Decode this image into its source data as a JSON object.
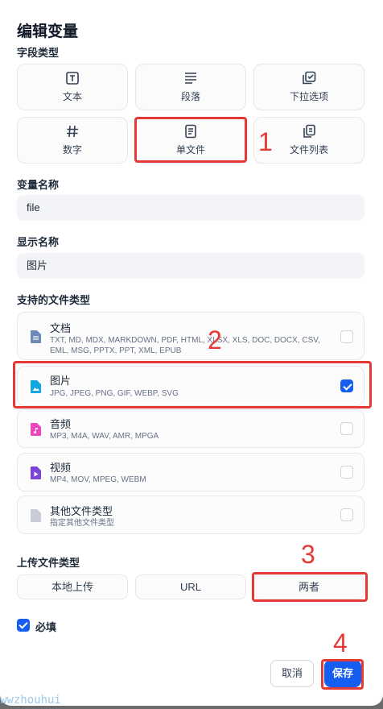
{
  "dialog": {
    "title": "编辑变量"
  },
  "field_type": {
    "label": "字段类型",
    "options": [
      {
        "label": "文本",
        "icon": "text-box-icon"
      },
      {
        "label": "段落",
        "icon": "paragraph-icon"
      },
      {
        "label": "下拉选项",
        "icon": "checkbox-list-icon"
      },
      {
        "label": "数字",
        "icon": "hash-icon"
      },
      {
        "label": "单文件",
        "icon": "file-doc-icon"
      },
      {
        "label": "文件列表",
        "icon": "file-copy-icon"
      }
    ],
    "selected": "单文件"
  },
  "variable_name": {
    "label": "变量名称",
    "value": "file"
  },
  "display_name": {
    "label": "显示名称",
    "value": "图片"
  },
  "supported_types": {
    "label": "支持的文件类型",
    "items": [
      {
        "name": "文档",
        "desc": "TXT, MD, MDX, MARKDOWN, PDF, HTML, XLSX, XLS, DOC, DOCX, CSV, EML, MSG, PPTX, PPT, XML, EPUB",
        "checked": false,
        "color": "#6e8bb8"
      },
      {
        "name": "图片",
        "desc": "JPG, JPEG, PNG, GIF, WEBP, SVG",
        "checked": true,
        "color": "#11a7e0"
      },
      {
        "name": "音频",
        "desc": "MP3, M4A, WAV, AMR, MPGA",
        "checked": false,
        "color": "#ee46bc"
      },
      {
        "name": "视频",
        "desc": "MP4, MOV, MPEG, WEBM",
        "checked": false,
        "color": "#7a44d8"
      },
      {
        "name": "其他文件类型",
        "desc": "指定其他文件类型",
        "checked": false,
        "color": "#c9ccd6"
      }
    ]
  },
  "upload_type": {
    "label": "上传文件类型",
    "options": [
      "本地上传",
      "URL",
      "两者"
    ],
    "selected": "两者"
  },
  "required": {
    "label": "必填",
    "checked": true
  },
  "buttons": {
    "cancel": "取消",
    "save": "保存"
  },
  "annotations": [
    "1",
    "2",
    "3",
    "4"
  ],
  "watermark": "wwzhouhui"
}
